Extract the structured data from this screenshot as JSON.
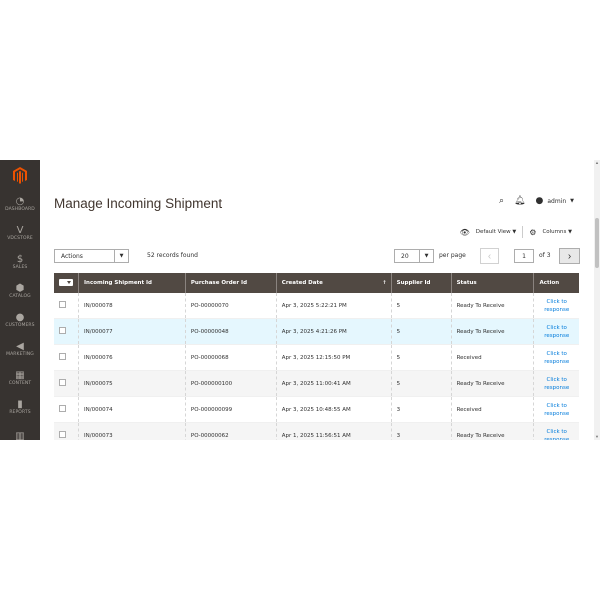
{
  "sidebar": {
    "logo_color": "#eb5202",
    "items": [
      {
        "label": "DASHBOARD",
        "icon": "dashboard-icon",
        "glyph": "◔"
      },
      {
        "label": "VDCSTORE",
        "icon": "vdcstore-icon",
        "glyph": "V"
      },
      {
        "label": "SALES",
        "icon": "dollar-icon",
        "glyph": "$"
      },
      {
        "label": "CATALOG",
        "icon": "box-icon",
        "glyph": "⬢"
      },
      {
        "label": "CUSTOMERS",
        "icon": "user-icon",
        "glyph": "●"
      },
      {
        "label": "MARKETING",
        "icon": "megaphone-icon",
        "glyph": "◀"
      },
      {
        "label": "CONTENT",
        "icon": "content-icon",
        "glyph": "▦"
      },
      {
        "label": "REPORTS",
        "icon": "bar-chart-icon",
        "glyph": "▮"
      },
      {
        "label": "",
        "icon": "store-icon",
        "glyph": "▥"
      }
    ]
  },
  "header": {
    "title": "Manage Incoming Shipment",
    "user": "admin",
    "view_label": "Default View",
    "columns_label": "Columns"
  },
  "toolbar": {
    "actions_label": "Actions",
    "records": "52 records found",
    "per_page_value": "20",
    "per_page_label": "per page",
    "page_value": "1",
    "page_of": "of 3"
  },
  "grid": {
    "columns": [
      "Incoming Shipment Id",
      "Purchase Order Id",
      "Created Date",
      "Supplier Id",
      "Status",
      "Action"
    ],
    "rows": [
      {
        "id": "IN/000078",
        "po": "PO-00000070",
        "date": "Apr 3, 2025 5:22:21 PM",
        "supplier": "5",
        "status": "Ready To Receive",
        "action": "Click to response"
      },
      {
        "id": "IN/000077",
        "po": "PO-00000048",
        "date": "Apr 3, 2025 4:21:26 PM",
        "supplier": "5",
        "status": "Ready To Receive",
        "action": "Click to response"
      },
      {
        "id": "IN/000076",
        "po": "PO-00000068",
        "date": "Apr 3, 2025 12:15:50 PM",
        "supplier": "5",
        "status": "Received",
        "action": "Click to response"
      },
      {
        "id": "IN/000075",
        "po": "PO-000000100",
        "date": "Apr 3, 2025 11:00:41 AM",
        "supplier": "5",
        "status": "Ready To Receive",
        "action": "Click to response"
      },
      {
        "id": "IN/000074",
        "po": "PO-000000099",
        "date": "Apr 3, 2025 10:48:55 AM",
        "supplier": "3",
        "status": "Received",
        "action": "Click to response"
      },
      {
        "id": "IN/000073",
        "po": "PO-00000062",
        "date": "Apr 1, 2025 11:56:51 AM",
        "supplier": "3",
        "status": "Ready To Receive",
        "action": "Click to response"
      }
    ]
  }
}
